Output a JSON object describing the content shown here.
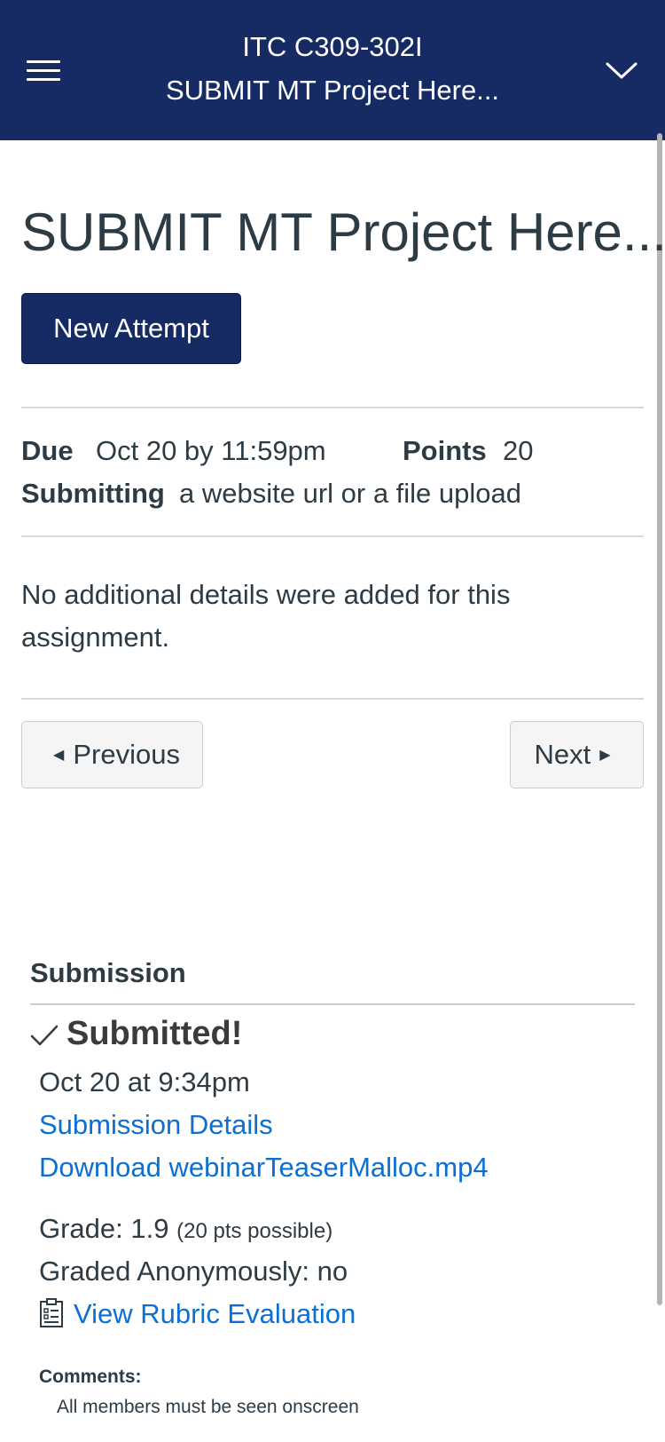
{
  "header": {
    "course": "ITC C309-302I",
    "assignment": "SUBMIT MT Project Here...",
    "menu_icon": "hamburger-icon",
    "dropdown_icon": "chevron-down-icon",
    "background_color": "#162a63"
  },
  "assignment": {
    "title": "SUBMIT MT Project Here...",
    "new_attempt_label": "New Attempt",
    "due_label": "Due",
    "due_value": "Oct 20 by 11:59pm",
    "points_label": "Points",
    "points_value": "20",
    "submitting_label": "Submitting",
    "submitting_value": "a website url or a file upload",
    "description": "No additional details were added for this assignment."
  },
  "navigation": {
    "previous_label": "Previous",
    "next_label": "Next"
  },
  "submission": {
    "heading": "Submission",
    "status": "Submitted!",
    "submitted_at": "Oct 20 at 9:34pm",
    "details_link": "Submission Details",
    "download_link": "Download webinarTeaserMalloc.mp4",
    "grade_label": "Grade: 1.9",
    "grade_possible": "(20 pts possible)",
    "graded_anonymously": "Graded Anonymously: no",
    "rubric_link": "View Rubric Evaluation",
    "comments_label": "Comments:",
    "comment": "All members must be seen onscreen"
  },
  "colors": {
    "accent": "#162a63",
    "link": "#0b6fd4",
    "text": "#2d3b45"
  }
}
